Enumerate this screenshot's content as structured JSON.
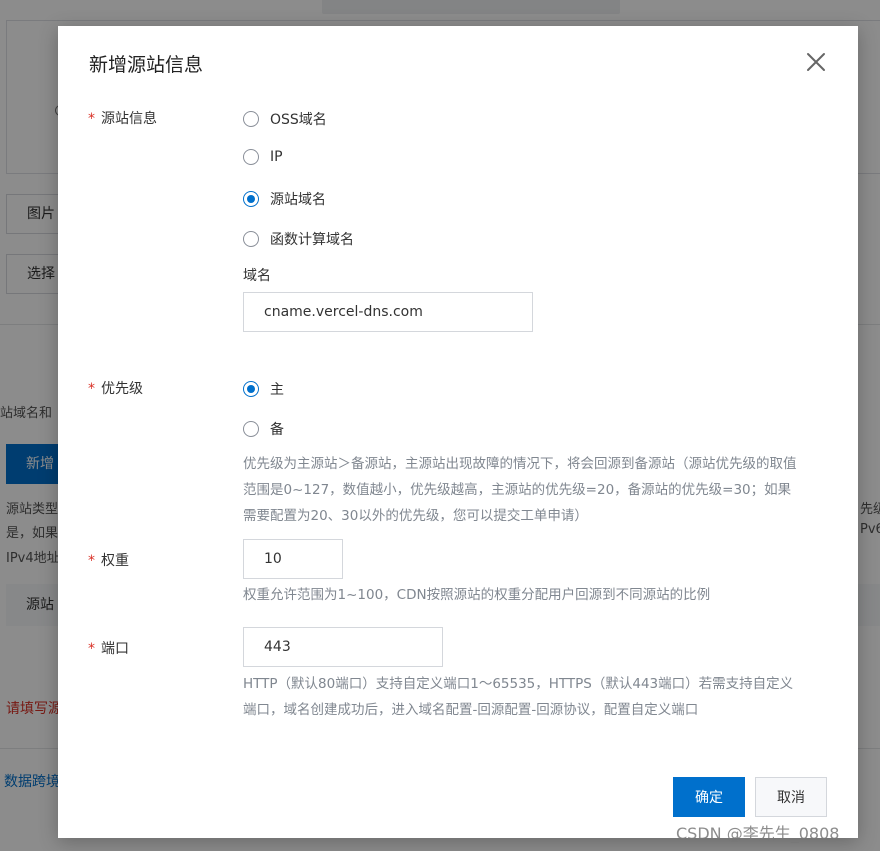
{
  "background": {
    "tab_partial": "图片",
    "select_partial": "选择",
    "desc_partial": "站域名和",
    "new_button_partial": "新增",
    "line1_partial": "源站类型",
    "line2_partial": "是，如果",
    "line3_partial": "IPv4地址",
    "strip_label_partial": "源站",
    "right_line1_partial": "先级和",
    "right_line2_partial": "Pv6",
    "error_partial": "请填写源",
    "link_partial": "数据跨境"
  },
  "dialog": {
    "title": "新增源站信息",
    "close_icon": "close-icon",
    "origin": {
      "label": "源站信息",
      "options": [
        "OSS域名",
        "IP",
        "源站域名",
        "函数计算域名"
      ],
      "selected_index": 2,
      "domain_label": "域名",
      "domain_value": "cname.vercel-dns.com"
    },
    "priority": {
      "label": "优先级",
      "options": [
        "主",
        "备"
      ],
      "selected_index": 0,
      "help": "优先级为主源站＞备源站，主源站出现故障的情况下，将会回源到备源站（源站优先级的取值范围是0~127，数值越小，优先级越高，主源站的优先级=20，备源站的优先级=30；如果需要配置为20、30以外的优先级，您可以提交工单申请）"
    },
    "weight": {
      "label": "权重",
      "value": "10",
      "help": "权重允许范围为1~100，CDN按照源站的权重分配用户回源到不同源站的比例"
    },
    "port": {
      "label": "端口",
      "value": "443",
      "help": "HTTP（默认80端口）支持自定义端口1～65535，HTTPS（默认443端口）若需支持自定义端口，域名创建成功后，进入域名配置-回源配置-回源协议，配置自定义端口"
    },
    "required_mark": "*",
    "confirm_label": "确定",
    "cancel_label": "取消"
  },
  "watermark": "CSDN @李先生_0808",
  "colors": {
    "primary": "#0070cc",
    "required": "#d93026",
    "help_text": "#808790"
  }
}
